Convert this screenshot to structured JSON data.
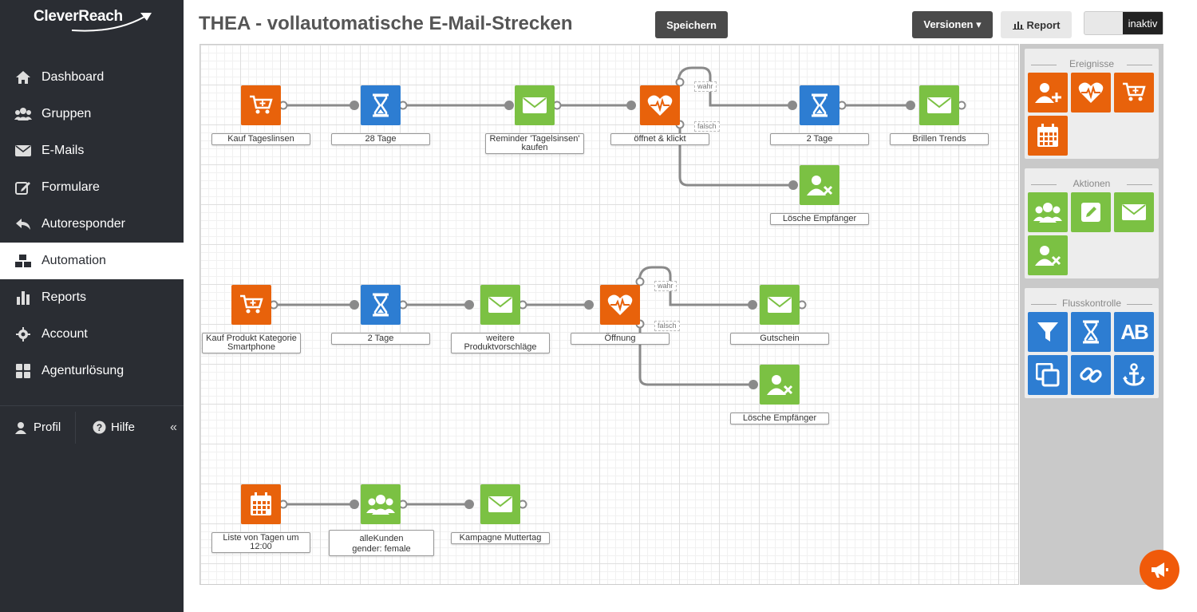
{
  "brand": {
    "name": "CleverReach"
  },
  "sidebar": {
    "items": [
      {
        "label": "Dashboard",
        "icon": "home-icon"
      },
      {
        "label": "Gruppen",
        "icon": "users-icon"
      },
      {
        "label": "E-Mails",
        "icon": "envelope-icon"
      },
      {
        "label": "Formulare",
        "icon": "edit-form-icon"
      },
      {
        "label": "Autoresponder",
        "icon": "reply-icon"
      },
      {
        "label": "Automation",
        "icon": "cubes-icon",
        "active": true
      },
      {
        "label": "Reports",
        "icon": "bar-chart-icon"
      },
      {
        "label": "Account",
        "icon": "gear-icon"
      },
      {
        "label": "Agenturlösung",
        "icon": "grid-icon"
      }
    ],
    "profile_label": "Profil",
    "help_label": "Hilfe",
    "collapse_glyph": "«"
  },
  "header": {
    "title": "THEA - vollautomatische E-Mail-Strecken",
    "save_label": "Speichern",
    "versions_label": "Versionen ▾",
    "report_label": "Report",
    "toggle_state": "inaktiv"
  },
  "flow": {
    "row1": {
      "n1": "Kauf Tageslinsen",
      "n2": "28 Tage",
      "n3": "Reminder 'Tagelsinsen' kaufen",
      "n4": "öffnet & klickt",
      "n5": "2 Tage",
      "n6": "Brillen Trends",
      "n7": "Lösche Empfänger",
      "true_tag": "wahr",
      "false_tag": "falsch"
    },
    "row2": {
      "n1": "Kauf Produkt Kategorie Smartphone",
      "n2": "2 Tage",
      "n3": "weitere Produktvorschläge",
      "n4": "Öffnung",
      "n5": "Gutschein",
      "n6": "Lösche Empfänger",
      "true_tag": "wahr",
      "false_tag": "falsch"
    },
    "row3": {
      "n1": "Liste von Tagen um 12:00",
      "n2a": "alleKunden",
      "n2b": "gender: female",
      "n3": "Kampagne Muttertag"
    }
  },
  "panel": {
    "events_title": "Ereignisse",
    "actions_title": "Aktionen",
    "flow_title": "Flusskontrolle",
    "flow_tile_text": "AB"
  },
  "colors": {
    "event": "#e8620b",
    "timing": "#2d7dd2",
    "action": "#7bc143",
    "sidebar": "#2a2d33"
  }
}
